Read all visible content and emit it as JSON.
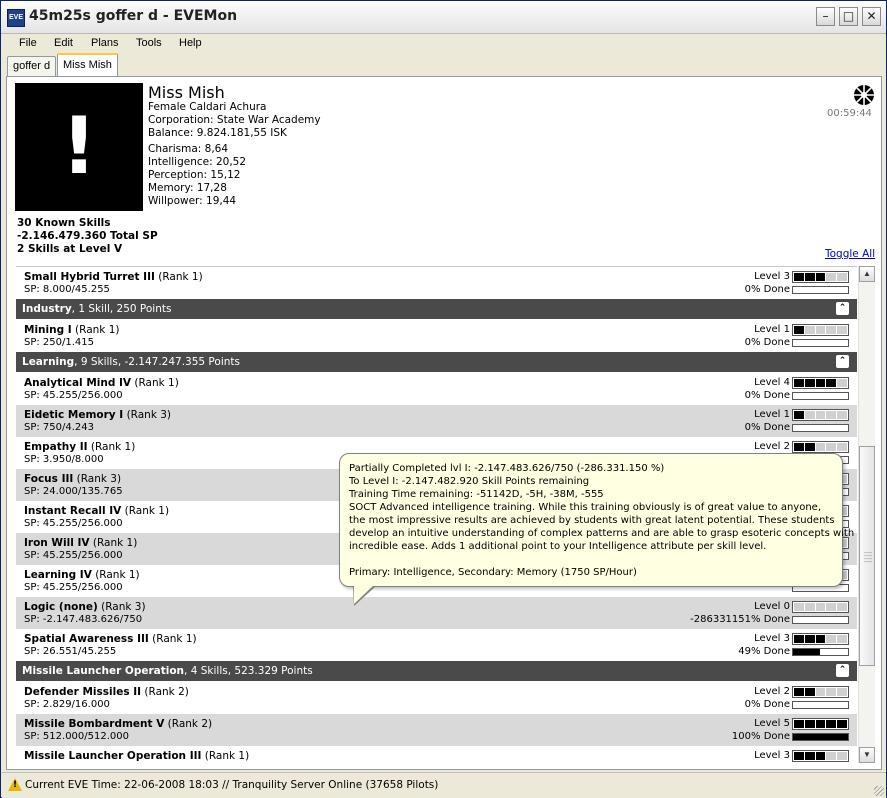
{
  "window": {
    "title": "45m25s goffer d - EVEMon",
    "app_icon": "eve"
  },
  "menu": [
    "File",
    "Edit",
    "Plans",
    "Tools",
    "Help"
  ],
  "tabs": [
    "goffer d",
    "Miss Mish"
  ],
  "character": {
    "name": "Miss Mish",
    "bio": "Female Caldari Achura",
    "corporation": "Corporation: State War Academy",
    "balance": "Balance: 9.824.181,55 ISK",
    "attributes": [
      "Charisma: 8,64",
      "Intelligence: 20,52",
      "Perception: 15,12",
      "Memory: 17,28",
      "Willpower: 19,44"
    ],
    "timer": "00:59:44"
  },
  "summary": {
    "known": "30 Known Skills",
    "total_sp": "-2.146.479.360 Total SP",
    "level_v": "2 Skills at Level V"
  },
  "toggle_all": "Toggle All",
  "skill_list": {
    "rows": [
      {
        "type": "skill",
        "name": "Small Hybrid Turret III",
        "rank": "(Rank 1)",
        "sp": "SP: 8.000/45.255",
        "level_text": "Level 3",
        "level": 3,
        "done": "0% Done",
        "pct": 0,
        "alt": false
      },
      {
        "type": "group",
        "name": "Industry",
        "meta": ", 1 Skill, 250 Points"
      },
      {
        "type": "skill",
        "name": "Mining I",
        "rank": "(Rank 1)",
        "sp": "SP: 250/1.415",
        "level_text": "Level 1",
        "level": 1,
        "done": "0% Done",
        "pct": 0,
        "alt": false
      },
      {
        "type": "group",
        "name": "Learning",
        "meta": ", 9 Skills, -2.147.247.355 Points"
      },
      {
        "type": "skill",
        "name": "Analytical Mind IV",
        "rank": "(Rank 1)",
        "sp": "SP: 45.255/256.000",
        "level_text": "Level 4",
        "level": 4,
        "done": "0% Done",
        "pct": 0,
        "alt": false
      },
      {
        "type": "skill",
        "name": "Eidetic Memory I",
        "rank": "(Rank 3)",
        "sp": "SP: 750/4.243",
        "level_text": "Level 1",
        "level": 1,
        "done": "0% Done",
        "pct": 0,
        "alt": true
      },
      {
        "type": "skill",
        "name": "Empathy II",
        "rank": "(Rank 1)",
        "sp": "SP: 3.950/8.000",
        "level_text": "Level 2",
        "level": 2,
        "done": "",
        "pct": 0,
        "alt": false
      },
      {
        "type": "skill",
        "name": "Focus III",
        "rank": "(Rank 3)",
        "sp": "SP: 24.000/135.765",
        "level_text": "",
        "level": 3,
        "done": "",
        "pct": 0,
        "alt": true
      },
      {
        "type": "skill",
        "name": "Instant Recall IV",
        "rank": "(Rank 1)",
        "sp": "SP: 45.255/256.000",
        "level_text": "",
        "level": 4,
        "done": "",
        "pct": 0,
        "alt": false
      },
      {
        "type": "skill",
        "name": "Iron Will IV",
        "rank": "(Rank 1)",
        "sp": "SP: 45.255/256.000",
        "level_text": "",
        "level": 4,
        "done": "",
        "pct": 0,
        "alt": true
      },
      {
        "type": "skill",
        "name": "Learning IV",
        "rank": "(Rank 1)",
        "sp": "SP: 45.255/256.000",
        "level_text": "",
        "level": 4,
        "done": "",
        "pct": 0,
        "alt": false
      },
      {
        "type": "skill",
        "name": "Logic (none)",
        "rank": "(Rank 3)",
        "sp": "SP: -2.147.483.626/750",
        "level_text": "Level 0",
        "level": 0,
        "done": "-286331151% Done",
        "pct": 0,
        "alt": true
      },
      {
        "type": "skill",
        "name": "Spatial Awareness III",
        "rank": "(Rank 1)",
        "sp": "SP: 26.551/45.255",
        "level_text": "Level 3",
        "level": 3,
        "done": "49% Done",
        "pct": 49,
        "alt": false
      },
      {
        "type": "group",
        "name": "Missile Launcher Operation",
        "meta": ", 4 Skills, 523.329 Points"
      },
      {
        "type": "skill",
        "name": "Defender Missiles II",
        "rank": "(Rank 2)",
        "sp": "SP: 2.829/16.000",
        "level_text": "Level 2",
        "level": 2,
        "done": "0% Done",
        "pct": 0,
        "alt": false
      },
      {
        "type": "skill",
        "name": "Missile Bombardment V",
        "rank": "(Rank 2)",
        "sp": "SP: 512.000/512.000",
        "level_text": "Level 5",
        "level": 5,
        "done": "100% Done",
        "pct": 100,
        "alt": true
      },
      {
        "type": "skill",
        "name": "Missile Launcher Operation III",
        "rank": "(Rank 1)",
        "sp": "",
        "level_text": "Level 3",
        "level": 3,
        "done": "",
        "pct": 0,
        "alt": false
      }
    ]
  },
  "tooltip": {
    "lines": [
      "Partially Completed lvl I: -2.147.483.626/750 (-286.331.150 %)",
      "To Level I: -2.147.482.920 Skill Points remaining",
      "Training Time remaining: -51142D, -5H, -38M, -555",
      " SOCT Advanced intelligence training. While this training obviously is of great value to anyone,",
      "the most impressive results are achieved by students with great latent potential. These students",
      "develop an intuitive understanding of complex patterns and are able to grasp esoteric concepts with",
      "incredible ease. Adds 1 additional point to your Intelligence attribute per skill level.",
      "",
      "Primary: Intelligence, Secondary: Memory (1750 SP/Hour)"
    ]
  },
  "status": {
    "text": "Current EVE Time: 22-06-2008 18:03  // Tranquility Server Online (37658 Pilots)",
    "icon": "warning-icon"
  }
}
